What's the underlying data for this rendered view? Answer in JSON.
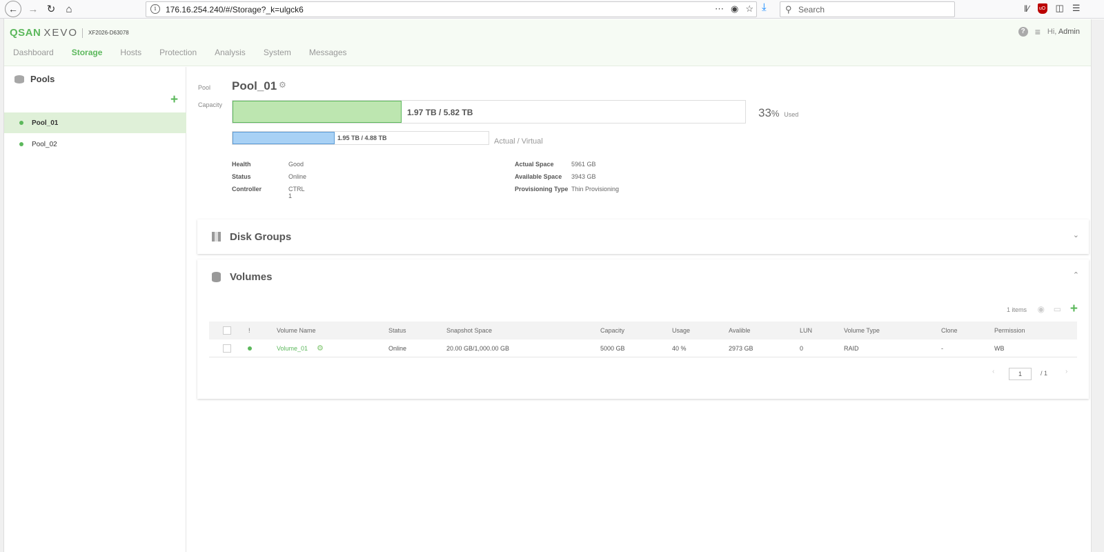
{
  "browser": {
    "url": "176.16.254.240/#/Storage?_k=ulgck6",
    "search_placeholder": "Search",
    "info_glyph": "i",
    "ublock_label": "uO"
  },
  "header": {
    "brand_qsan": "QSAN",
    "brand_xevo": "XEVO",
    "model": "XF2026-D63078",
    "greeting_prefix": "Hi,",
    "user": "Admin",
    "help_glyph": "?"
  },
  "nav": [
    "Dashboard",
    "Storage",
    "Hosts",
    "Protection",
    "Analysis",
    "System",
    "Messages"
  ],
  "nav_active": "Storage",
  "sidebar": {
    "title": "Pools",
    "add_glyph": "+",
    "pools": [
      "Pool_01",
      "Pool_02"
    ],
    "selected": "Pool_01"
  },
  "pool": {
    "label": "Pool",
    "name": "Pool_01",
    "capacity_label": "Capacity",
    "capacity_text": "1.97 TB / 5.82 TB",
    "capacity_fraction": 0.33,
    "used_pct": "33",
    "used_pct_sign": "%",
    "used_word": "Used",
    "virtual_text": "1.95 TB / 4.88 TB",
    "virtual_fraction": 0.4,
    "virtual_label": "Actual / Virtual",
    "info_left": [
      {
        "k": "Health",
        "v": "Good"
      },
      {
        "k": "Status",
        "v": "Online"
      },
      {
        "k": "Controller",
        "v": "CTRL 1"
      }
    ],
    "info_right": [
      {
        "k": "Actual Space",
        "v": "5961 GB"
      },
      {
        "k": "Available Space",
        "v": "3943 GB"
      },
      {
        "k": "Provisioning Type",
        "v": "Thin Provisioning"
      }
    ]
  },
  "disk_groups": {
    "title": "Disk Groups",
    "chevron": "⌄"
  },
  "volumes": {
    "title": "Volumes",
    "chevron": "⌃",
    "items_count": "1 items",
    "add_glyph": "+",
    "columns": [
      "!",
      "Volume Name",
      "Status",
      "Snapshot Space",
      "Capacity",
      "Usage",
      "Avalible",
      "LUN",
      "Volume Type",
      "Clone",
      "Permission"
    ],
    "rows": [
      {
        "name": "Volume_01",
        "status": "Online",
        "snapshot": "20.00 GB/1,000.00 GB",
        "capacity": "5000 GB",
        "usage": "40 %",
        "available": "2973 GB",
        "lun": "0",
        "type": "RAID",
        "clone": "-",
        "permission": "WB"
      }
    ],
    "page": "1",
    "total_pages": "/  1",
    "prev_glyph": "‹",
    "next_glyph": "›"
  },
  "colors": {
    "accent": "#5cb85c",
    "capacity_fill": "#bde6b0",
    "virtual_fill": "#a8d1f5"
  }
}
